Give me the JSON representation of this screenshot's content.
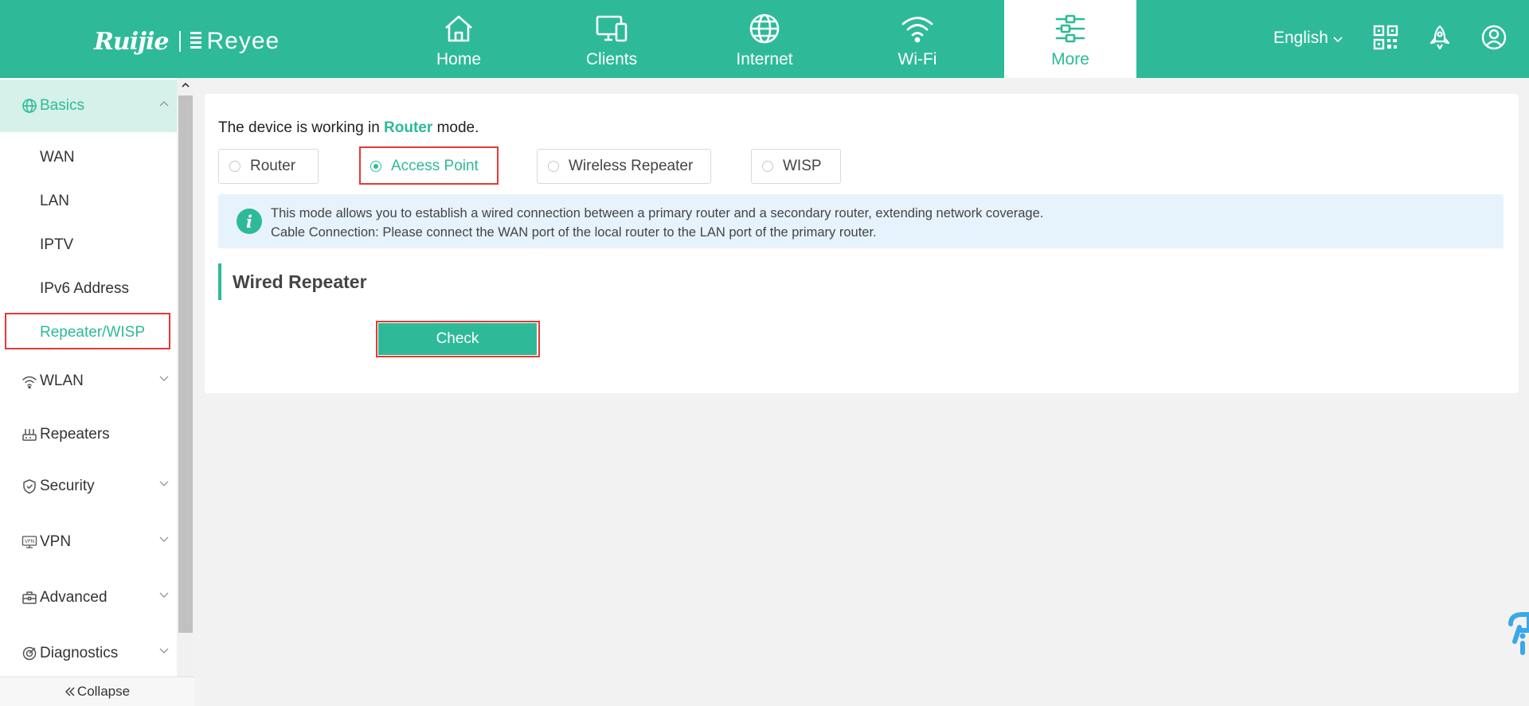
{
  "header": {
    "logo": {
      "ruijie": "Ruijie",
      "reyee": "Reyee"
    },
    "nav": [
      {
        "label": "Home",
        "icon": "home-icon"
      },
      {
        "label": "Clients",
        "icon": "devices-icon"
      },
      {
        "label": "Internet",
        "icon": "globe-icon"
      },
      {
        "label": "Wi-Fi",
        "icon": "wifi-icon"
      },
      {
        "label": "More",
        "icon": "sliders-icon",
        "active": true
      }
    ],
    "language": "English",
    "icons": [
      "qr-code-icon",
      "rocket-icon",
      "user-icon"
    ]
  },
  "sidebar": {
    "groups": [
      {
        "label": "Basics",
        "icon": "globe-icon",
        "expanded": true,
        "items": [
          "WAN",
          "LAN",
          "IPTV",
          "IPv6 Address",
          "Repeater/WISP"
        ],
        "active_item": "Repeater/WISP"
      },
      {
        "label": "WLAN",
        "icon": "wifi-icon"
      },
      {
        "label": "Repeaters",
        "icon": "repeater-icon"
      },
      {
        "label": "Security",
        "icon": "shield-icon"
      },
      {
        "label": "VPN",
        "icon": "vpn-icon"
      },
      {
        "label": "Advanced",
        "icon": "toolbox-icon"
      },
      {
        "label": "Diagnostics",
        "icon": "diagnostics-icon"
      }
    ],
    "collapse_label": "Collapse"
  },
  "main": {
    "status_prefix": "The device is working in",
    "status_mode": "Router",
    "status_suffix": "mode.",
    "modes": [
      {
        "label": "Router",
        "checked": false
      },
      {
        "label": "Access Point",
        "checked": true
      },
      {
        "label": "Wireless Repeater",
        "checked": false
      },
      {
        "label": "WISP",
        "checked": false
      }
    ],
    "info": {
      "line1": "This mode allows you to establish a wired connection between a primary router and a secondary router, extending network coverage.",
      "line2": "Cable Connection: Please connect the WAN port of the local router to the LAN port of the primary router."
    },
    "section_title": "Wired Repeater",
    "check_button": "Check"
  },
  "colors": {
    "accent": "#2eba98",
    "highlight": "#e53935",
    "info_bg": "#e7f3fc"
  }
}
